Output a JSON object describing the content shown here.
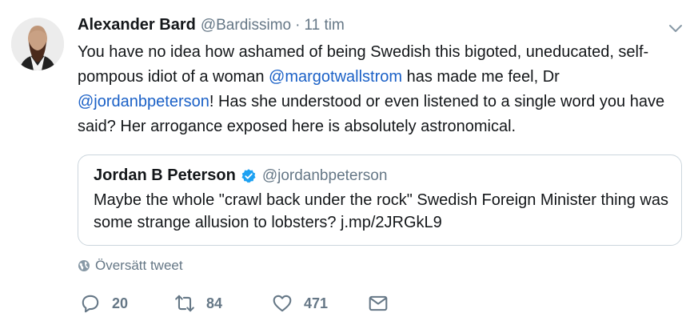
{
  "tweet": {
    "author_name": "Alexander Bard",
    "author_handle": "@Bardissimo",
    "separator": "·",
    "time": "11 tim",
    "text_part1": "You have no idea how ashamed of being Swedish this bigoted, uneducated, self-pompous idiot of a woman ",
    "mention1": "@margotwallstrom",
    "text_part2": " has made me feel, Dr ",
    "mention2": "@jordanbpeterson",
    "text_part3": "! Has she understood or even listened to a single word you have said? Her arrogance exposed here is absolutely astronomical."
  },
  "quote": {
    "author_name": "Jordan B Peterson",
    "author_handle": "@jordanbpeterson",
    "verified": true,
    "text": "Maybe the whole \"crawl back under the rock\" Swedish Foreign Minister thing was some strange allusion to lobsters? j.mp/2JRGkL9"
  },
  "translate_label": "Översätt tweet",
  "actions": {
    "replies": "20",
    "retweets": "84",
    "likes": "471"
  },
  "icons": {
    "avatar": "profile-photo",
    "menu": "chevron-down-icon",
    "verified": "verified-badge-icon",
    "translate": "globe-icon",
    "reply": "reply-icon",
    "retweet": "retweet-icon",
    "like": "heart-icon",
    "message": "envelope-icon"
  },
  "colors": {
    "link": "#1b61c7",
    "secondary": "#657786",
    "verified": "#1da1f2",
    "border": "#ccd6dd"
  }
}
